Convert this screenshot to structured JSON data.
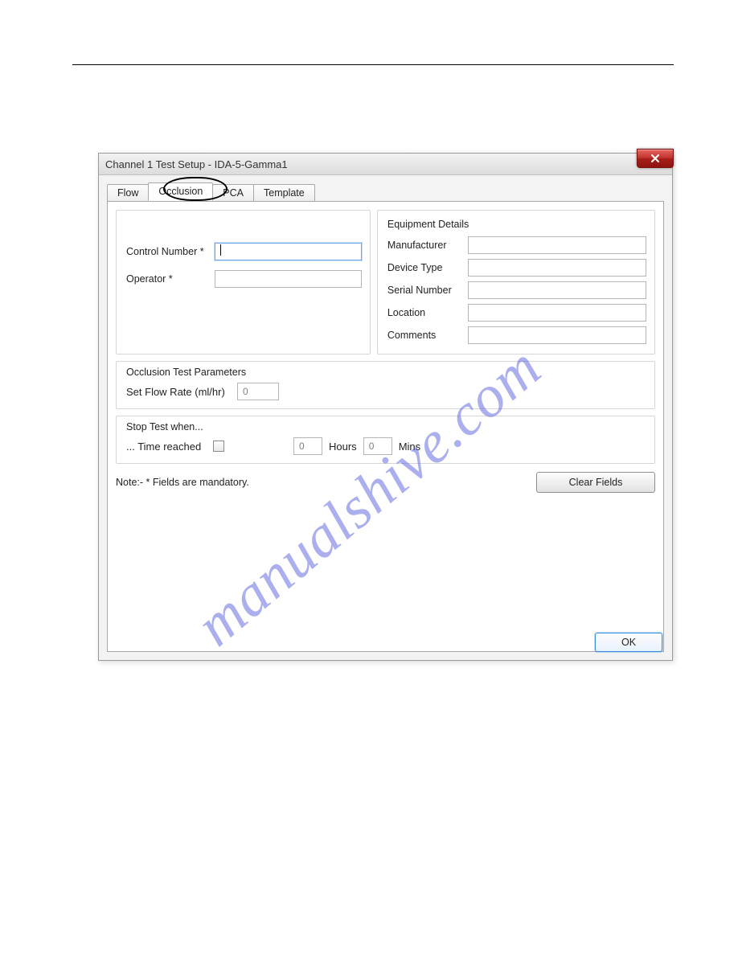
{
  "dialog": {
    "title": "Channel 1 Test Setup - IDA-5-Gamma1",
    "tabs": [
      "Flow",
      "Occlusion",
      "PCA",
      "Template"
    ],
    "active_tab": "Occlusion",
    "left": {
      "control_number_label": "Control Number *",
      "control_number_value": "",
      "operator_label": "Operator *",
      "operator_value": ""
    },
    "equipment": {
      "title": "Equipment Details",
      "manufacturer_label": "Manufacturer",
      "manufacturer_value": "",
      "device_type_label": "Device Type",
      "device_type_value": "",
      "serial_number_label": "Serial Number",
      "serial_number_value": "",
      "location_label": "Location",
      "location_value": "",
      "comments_label": "Comments",
      "comments_value": ""
    },
    "occlusion_params": {
      "title": "Occlusion Test Parameters",
      "flow_rate_label": "Set Flow Rate (ml/hr)",
      "flow_rate_value": "0"
    },
    "stop_test": {
      "title": "Stop Test when...",
      "time_reached_label": "... Time reached",
      "time_reached_checked": false,
      "hours_value": "0",
      "hours_label": "Hours",
      "mins_value": "0",
      "mins_label": "Mins"
    },
    "note_text": "Note:-  * Fields are mandatory.",
    "clear_fields_label": "Clear Fields",
    "ok_label": "OK"
  },
  "watermark": "manualshive.com"
}
